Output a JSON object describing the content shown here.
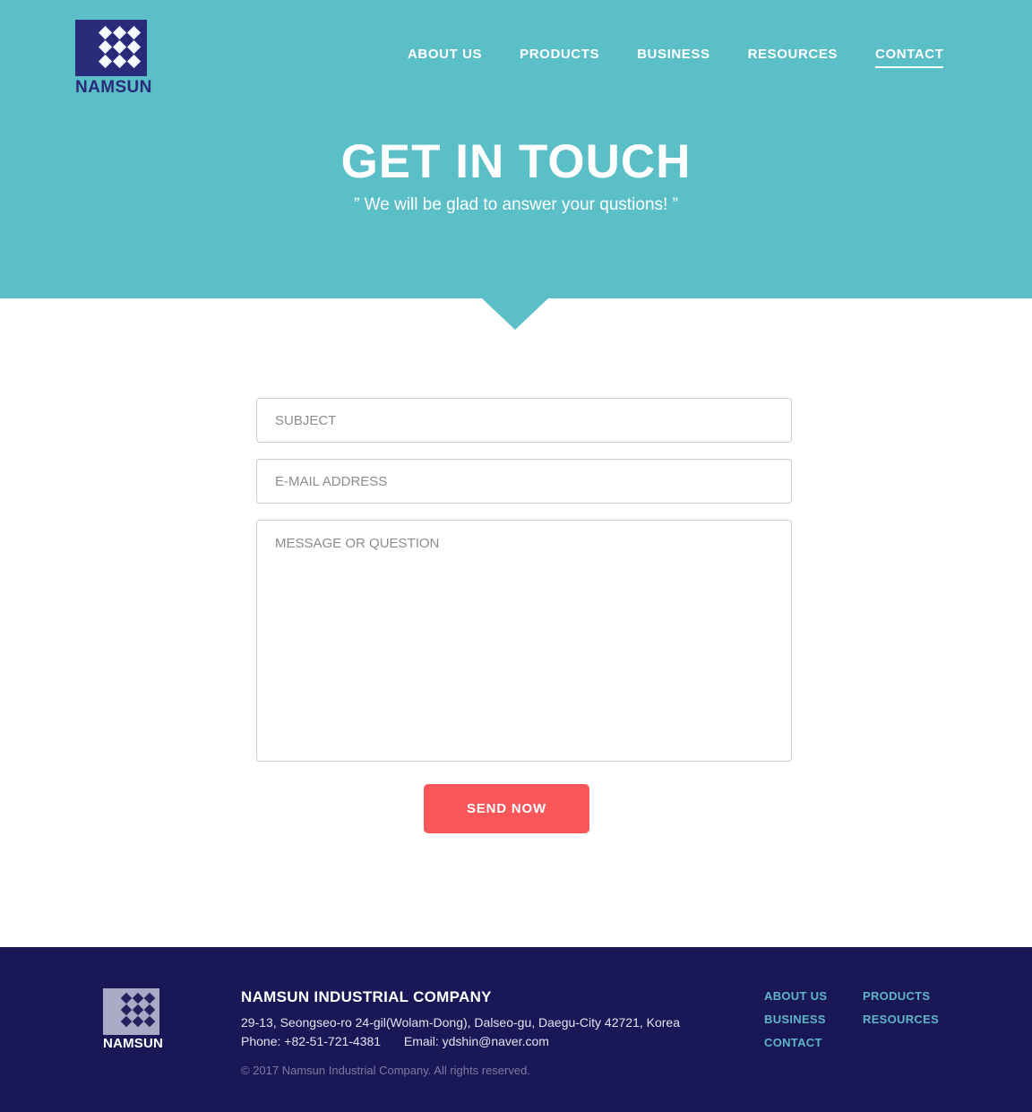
{
  "brand": {
    "name": "NAMSUN",
    "logo_icon": "namsun-diamond-grid-logo",
    "navy": "#2a2a7a",
    "teal": "#5abfc6",
    "coral": "#f9565a",
    "footer_navy": "#1a1757"
  },
  "nav": {
    "items": [
      {
        "label": "ABOUT US",
        "active": false
      },
      {
        "label": "PRODUCTS",
        "active": false
      },
      {
        "label": "BUSINESS",
        "active": false
      },
      {
        "label": "RESOURCES",
        "active": false
      },
      {
        "label": "CONTACT",
        "active": true
      }
    ]
  },
  "hero": {
    "title": "GET IN TOUCH",
    "subtitle": "” We will be glad to answer your qustions! ”"
  },
  "form": {
    "subject_placeholder": "SUBJECT",
    "subject_value": "",
    "email_placeholder": "E-MAIL ADDRESS",
    "email_value": "",
    "message_placeholder": "MESSAGE OR QUESTION",
    "message_value": "",
    "submit_label": "SEND NOW"
  },
  "footer": {
    "logo_name": "NAMSUN",
    "company": "NAMSUN INDUSTRIAL COMPANY",
    "address": "29-13, Seongseo-ro 24-gil(Wolam-Dong), Dalseo-gu, Daegu-City 42721, Korea",
    "phone_label": "Phone: +82-51-721-4381",
    "email_label": "Email: ydshin@naver.com",
    "copyright": "© 2017 Namsun Industrial Company. All rights reserved.",
    "links": [
      {
        "label": "ABOUT US"
      },
      {
        "label": "PRODUCTS"
      },
      {
        "label": "BUSINESS"
      },
      {
        "label": "RESOURCES"
      },
      {
        "label": "CONTACT"
      }
    ]
  }
}
